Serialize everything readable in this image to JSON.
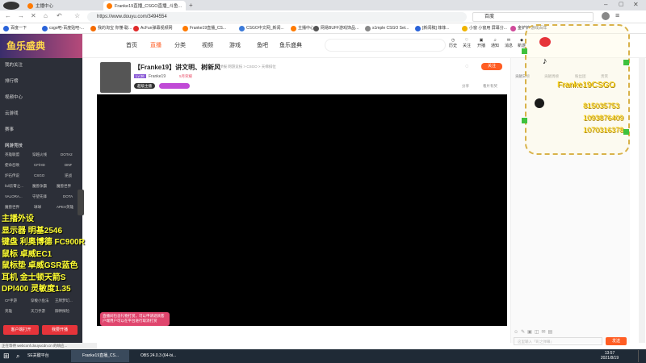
{
  "browser": {
    "tabs": [
      {
        "label": "主播中心",
        "color": "#ff7a00"
      },
      {
        "label": "Franke19直播_CSGO直播_斗鱼...",
        "color": "#ff7a00"
      }
    ],
    "url": "https://www.douyu.com/3494554",
    "address_right": "百度",
    "bookmarks": [
      "百度一下",
      "csgo吧-百度贴吧-...",
      "我的淘宝 你懂-聪...",
      "AcFun弹幕视频网",
      "Franke19直播_CS...",
      "CSGO中文网_新闻...",
      "主播中心",
      "网易BUFF游戏饰品...",
      "s1mple CSGO Set...",
      "[新闻稿] 菲菲...",
      "小窗 小窗用 屏幕分...",
      "金铲铲 游戏百年"
    ]
  },
  "site": {
    "logo": "鱼乐盛典",
    "nav": [
      "首页",
      "直播",
      "分类",
      "视频",
      "游戏",
      "鱼吧",
      "鱼乐盛典"
    ],
    "header_icons": [
      "历史",
      "关注",
      "开播",
      "通知",
      "消息",
      "新游"
    ]
  },
  "sidebar": {
    "items": [
      "我的关注",
      "排行榜",
      "视频中心",
      "云游戏",
      "赛事"
    ],
    "section": "网游竞技",
    "games": [
      "英雄联盟",
      "穿越火线",
      "DOTA2",
      "使命召唤",
      "CF/HD",
      "DNF",
      "炉石传说",
      "CSGO",
      "逆战",
      "fall云霄之...",
      "魔兽争霸",
      "魔兽世界",
      "VALORA...",
      "守望先锋",
      "DOTA",
      "魔兽世界",
      "球球",
      "APEX英雄"
    ],
    "more_games": [
      "CF手游",
      "穿梭小鱼法",
      "王牌梦幻...",
      "英雄",
      "天刀手游",
      "御神探险"
    ],
    "buttons": [
      "客户端打开",
      "我要开播"
    ]
  },
  "overlay_text": [
    "主播外设",
    "显示器  明基2546",
    "键盘  利奥博德 FC900R",
    "鼠标  卓威EC1",
    "鼠标垫  卓威GSR蓝色",
    "耳机  金士顿天箭S",
    "DPI400  灵敏度1.35"
  ],
  "room": {
    "title": "【Franke19】讲文明、树新风",
    "breadcrumb": "举报  网游竞技 > CSGO > 天梯排位",
    "streamer": "Franke19",
    "level_badge": "Lv.36",
    "tags": [
      "5月荣耀",
      "超级主播"
    ],
    "follow_label": "关注",
    "share_label": "分享",
    "report_label": "看片有奖",
    "notice": "直播间包含礼物打赏，可以申请退款客户端用户可以在平台进行取消打赏"
  },
  "right_panel": {
    "tabs": [
      "贡献日榜",
      "贡献周榜",
      "粉丝团",
      "贵宾"
    ],
    "contact_lines": [
      "Franke19CSGO",
      "815035753",
      "1093876409",
      "1070316378"
    ],
    "placeholder": "这里输入「彩之弹幕」",
    "send_label": "发送"
  },
  "taskbar": {
    "items": [
      "SE关键平台",
      "Franke19直播_CS...",
      "OBS 24.0.3 (64-bi..."
    ],
    "time": "13:57",
    "date": "2021/8/19"
  },
  "statusbar": "正在等待 webconf.douyucdn.cn 的响应..."
}
